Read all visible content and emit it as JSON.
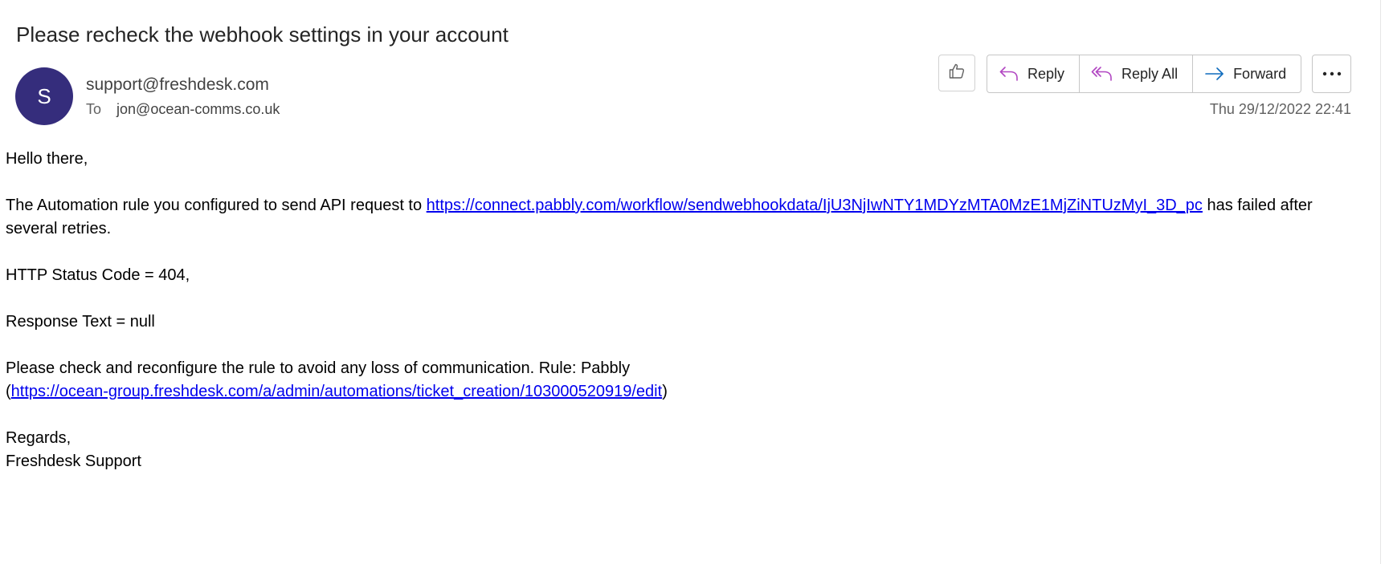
{
  "subject": "Please recheck the webhook settings in your account",
  "sender": {
    "avatar_initial": "S",
    "avatar_color": "#352d7c",
    "email": "support@freshdesk.com",
    "to_label": "To",
    "to_email": "jon@ocean-comms.co.uk"
  },
  "actions": {
    "like_icon": "thumbs-up-icon",
    "reply_label": "Reply",
    "reply_all_label": "Reply All",
    "forward_label": "Forward",
    "more_icon": "more-horizontal-icon",
    "accent_color": "#b146c2",
    "forward_color": "#0f6cbd"
  },
  "timestamp": "Thu 29/12/2022 22:41",
  "body": {
    "greeting": "Hello there,",
    "p1_before": "The Automation rule you configured to send API request to ",
    "p1_link": "https://connect.pabbly.com/workflow/sendwebhookdata/IjU3NjIwNTY1MDYzMTA0MzE1MjZiNTUzMyI_3D_pc",
    "p1_after": " has failed after several retries.",
    "status_code": "HTTP Status Code = 404,",
    "response_text": "Response Text = null",
    "p4_before": "Please check and reconfigure the rule to avoid any loss of communication. Rule: Pabbly (",
    "p4_link": "https://ocean-group.freshdesk.com/a/admin/automations/ticket_creation/103000520919/edit",
    "p4_after": ")",
    "regards": "Regards,",
    "signature": "Freshdesk Support"
  }
}
